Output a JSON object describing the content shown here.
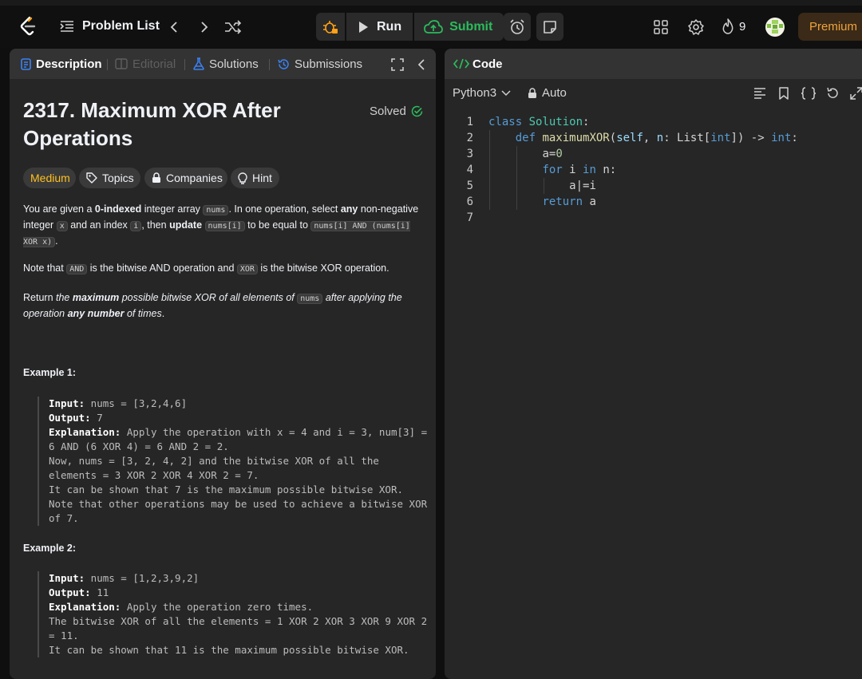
{
  "topbar": {
    "problem_list_label": "Problem List",
    "run_label": "Run",
    "submit_label": "Submit",
    "streak_count": "9",
    "premium_label": "Premium"
  },
  "description_panel": {
    "tabs": [
      {
        "label": "Description",
        "active": true
      },
      {
        "label": "Editorial",
        "disabled": true
      },
      {
        "label": "Solutions"
      },
      {
        "label": "Submissions"
      }
    ],
    "title": "2317. Maximum XOR After Operations",
    "status": "Solved",
    "tags": {
      "difficulty": "Medium",
      "topics": "Topics",
      "companies": "Companies",
      "hint": "Hint"
    },
    "paragraph1": {
      "t1": "You are given a ",
      "b1": "0-indexed",
      "t2": " integer array ",
      "c1": "nums",
      "t3": ". In one operation, select ",
      "b2": "any",
      "t4": " non-negative integer ",
      "c2": "x",
      "t5": " and an index ",
      "c3": "i",
      "t6": ", then ",
      "b3": "update",
      "t7": " ",
      "c4": "nums[i]",
      "t8": " to be equal to ",
      "c5": "nums[i] AND (nums[i] XOR x)",
      "t9": "."
    },
    "paragraph2": {
      "t1": "Note that ",
      "c1": "AND",
      "t2": " is the bitwise AND operation and ",
      "c2": "XOR",
      "t3": " is the bitwise XOR operation."
    },
    "paragraph3": {
      "t1": "Return ",
      "i1": "the ",
      "b1": "maximum",
      "i2": " possible bitwise XOR of all elements of ",
      "c1": "nums",
      "i3": " after applying the operation ",
      "b2": "any number",
      "i4": " of times",
      "t2": "."
    },
    "examples": [
      {
        "title": "Example 1:",
        "input_label": "Input:",
        "input": " nums = [3,2,4,6]",
        "output_label": "Output:",
        "output": " 7",
        "explanation_label": "Explanation:",
        "explanation": " Apply the operation with x = 4 and i = 3, num[3] = 6 AND (6 XOR 4) = 6 AND 2 = 2.\nNow, nums = [3, 2, 4, 2] and the bitwise XOR of all the elements = 3 XOR 2 XOR 4 XOR 2 = 7.\nIt can be shown that 7 is the maximum possible bitwise XOR.\nNote that other operations may be used to achieve a bitwise XOR of 7."
      },
      {
        "title": "Example 2:",
        "input_label": "Input:",
        "input": " nums = [1,2,3,9,2]",
        "output_label": "Output:",
        "output": " 11",
        "explanation_label": "Explanation:",
        "explanation": " Apply the operation zero times.\nThe bitwise XOR of all the elements = 1 XOR 2 XOR 3 XOR 9 XOR 2 = 11.\nIt can be shown that 11 is the maximum possible bitwise XOR."
      }
    ]
  },
  "code_panel": {
    "tab_label": "Code",
    "language": "Python3",
    "mode": "Auto",
    "line_numbers": [
      "1",
      "2",
      "3",
      "4",
      "5",
      "6",
      "7"
    ],
    "lines": [
      {
        "kw1": "class",
        "sp1": " ",
        "cls": "Solution",
        "rest": ":"
      },
      {
        "indent": "    ",
        "kw1": "def",
        "sp1": " ",
        "fn": "maximumXOR",
        "p1": "(",
        "self": "self",
        "p2": ", ",
        "n": "n",
        "p3": ": List[",
        "int1": "int",
        "p4": "]) -> ",
        "int2": "int",
        "p5": ":"
      },
      {
        "indent": "        ",
        "a": "a",
        "eq": "=",
        "zero": "0"
      },
      {
        "indent": "        ",
        "kw1": "for",
        "sp1": " ",
        "i": "i",
        "sp2": " ",
        "kw2": "in",
        "sp3": " ",
        "n": "n",
        "colon": ":"
      },
      {
        "indent": "            ",
        "text": "a|=i"
      },
      {
        "indent": "        ",
        "kw1": "return",
        "sp1": " ",
        "a": "a"
      },
      {
        "text": ""
      }
    ]
  }
}
